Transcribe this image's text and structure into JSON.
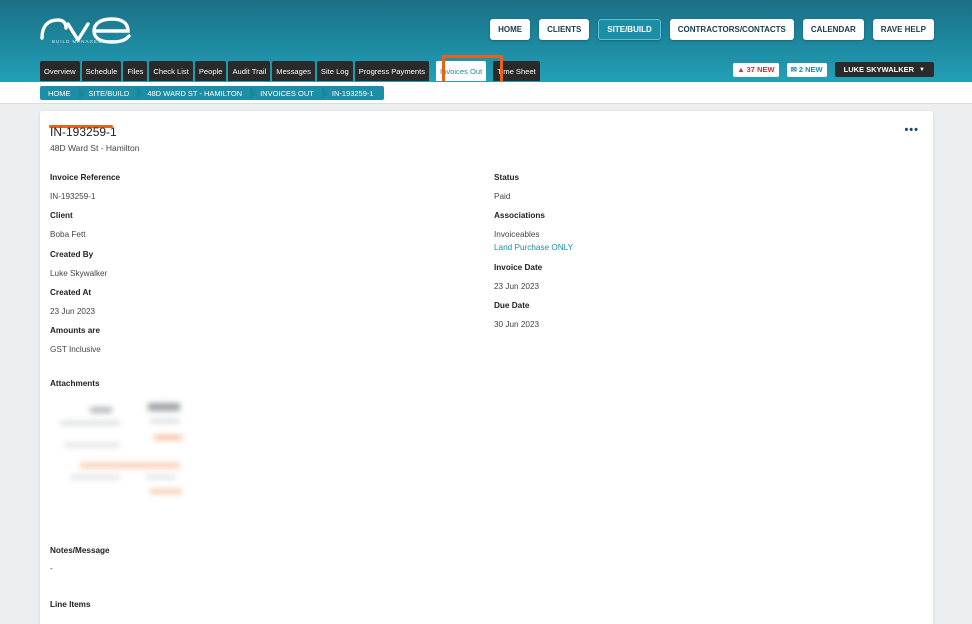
{
  "brand": {
    "logo_text": "rve",
    "tagline": "BUILD MANAGEMENT"
  },
  "topnav": [
    "HOME",
    "CLIENTS",
    "SITE/BUILD",
    "CONTRACTORS/CONTACTS",
    "CALENDAR",
    "RAVE HELP"
  ],
  "topnav_active": "SITE/BUILD",
  "tabs": [
    "Overview",
    "Schedule",
    "Files",
    "Check List",
    "People",
    "Audit Trail",
    "Messages",
    "Site Log",
    "Progress Payments",
    "Invoices Out",
    "Time Sheet"
  ],
  "active_tab": "Invoices Out",
  "notifications": {
    "alerts": "37 NEW",
    "messages": "2 NEW"
  },
  "user": {
    "name": "LUKE SKYWALKER"
  },
  "breadcrumb": [
    "HOME",
    "SITE/BUILD",
    "48D WARD ST - HAMILTON",
    "INVOICES OUT",
    "IN-193259-1"
  ],
  "invoice": {
    "title": "IN-193259-1",
    "subtitle": "48D Ward St - Hamilton",
    "left": [
      {
        "label": "Invoice Reference",
        "value": "IN-193259-1"
      },
      {
        "label": "Client",
        "value": "Boba Fett"
      },
      {
        "label": "Created By",
        "value": "Luke Skywalker"
      },
      {
        "label": "Created At",
        "value": "23 Jun 2023"
      },
      {
        "label": "Amounts are",
        "value": "GST Inclusive"
      }
    ],
    "status": {
      "label": "Status",
      "value": "Paid"
    },
    "associations": {
      "label": "Associations",
      "value": "Invoiceables",
      "link": "Land Purchase ONLY"
    },
    "invoice_date": {
      "label": "Invoice Date",
      "value": "23 Jun 2023"
    },
    "due_date": {
      "label": "Due Date",
      "value": "30 Jun 2023"
    },
    "attachments_label": "Attachments",
    "notes_label": "Notes/Message",
    "notes_value": "-",
    "line_items_label": "Line Items"
  },
  "colors": {
    "header": "#1d8aa1",
    "accent": "#1c8ea6",
    "highlight": "#e8611a",
    "tab_bg": "#2a2a2a"
  }
}
